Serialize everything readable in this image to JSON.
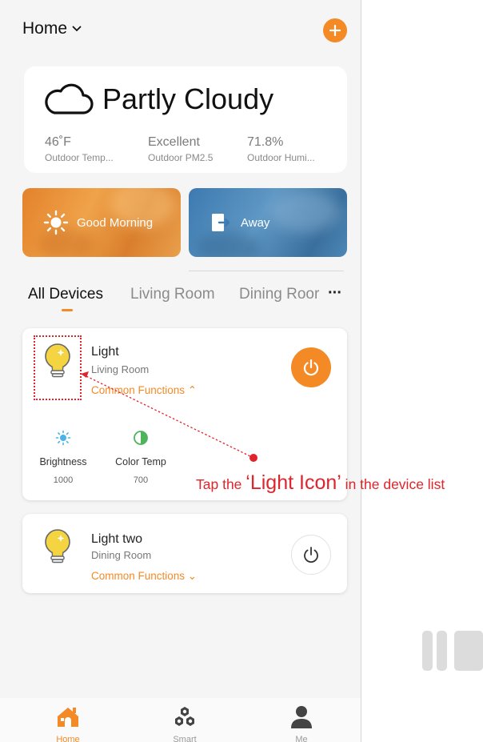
{
  "header": {
    "home_label": "Home"
  },
  "weather": {
    "condition": "Partly Cloudy",
    "stats": [
      {
        "value": "46˚F",
        "label": "Outdoor Temp..."
      },
      {
        "value": "Excellent",
        "label": "Outdoor PM2.5"
      },
      {
        "value": "71.8%",
        "label": "Outdoor Humi..."
      }
    ]
  },
  "scenes": [
    {
      "label": "Good Morning"
    },
    {
      "label": "Away"
    }
  ],
  "tabs": {
    "items": [
      "All Devices",
      "Living Room",
      "Dining Roor"
    ],
    "more": "···"
  },
  "devices": [
    {
      "name": "Light",
      "room": "Living Room",
      "functions_label": "Common Functions ⌃",
      "power": "on",
      "functions": [
        {
          "label": "Brightness",
          "value": "1000"
        },
        {
          "label": "Color Temp",
          "value": "700"
        }
      ]
    },
    {
      "name": "Light  two",
      "room": "Dining Room",
      "functions_label": "Common Functions ⌄",
      "power": "off"
    }
  ],
  "annotation": {
    "prefix": "Tap the ",
    "highlight": "‘Light Icon’",
    "suffix": " in the device list"
  },
  "nav": [
    {
      "label": "Home"
    },
    {
      "label": "Smart"
    },
    {
      "label": "Me"
    }
  ],
  "colors": {
    "accent": "#f38a26",
    "annotation": "#e0242b",
    "bulb": "#f5d442"
  }
}
